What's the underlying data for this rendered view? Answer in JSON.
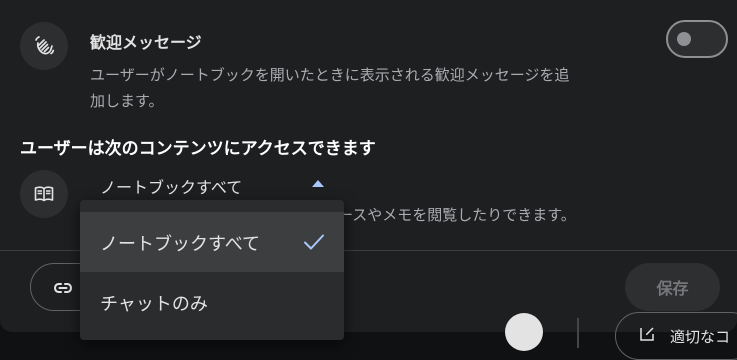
{
  "welcome": {
    "title": "歓迎メッセージ",
    "description_line1": "ユーザーがノートブックを開いたときに表示される歓迎メッセージを追",
    "description_line2": "加します。",
    "icon": "waving-hand-icon",
    "toggle_on": false
  },
  "access": {
    "heading": "ユーザーは次のコンテンツにアクセスできます",
    "icon": "book-icon",
    "selected_option": "ノートブックすべて",
    "description_visible": "ースやメモを閲覧したりできます。",
    "options": [
      {
        "label": "ノートブックすべて",
        "selected": true
      },
      {
        "label": "チャットのみ",
        "selected": false
      }
    ]
  },
  "footer": {
    "link_icon": "link-icon",
    "save_label": "保存"
  },
  "background": {
    "chip_text": "適切なコ"
  },
  "colors": {
    "dialog_bg": "#1e1f20",
    "accent": "#a8c7fa",
    "menu_bg": "#2b2c2e",
    "menu_selected_bg": "#3d3e40"
  }
}
